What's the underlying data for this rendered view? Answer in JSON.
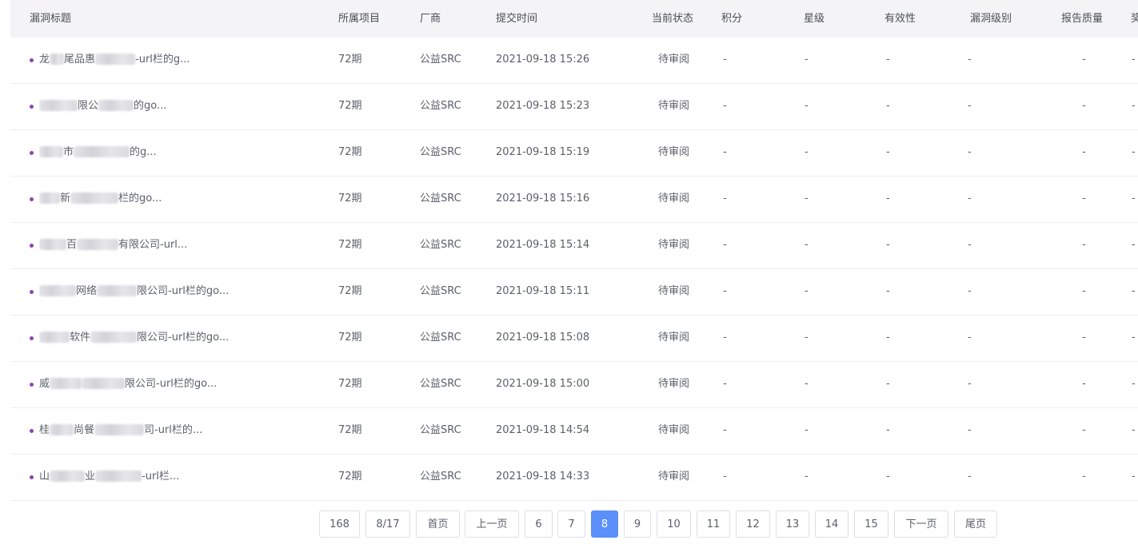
{
  "colors": {
    "bullet": "#8e44ad",
    "active_page": "#5b8ff9",
    "header_bg": "#f4f4f6"
  },
  "table": {
    "headers": {
      "title": "漏洞标题",
      "project": "所属项目",
      "vendor": "厂商",
      "submit_time": "提交时间",
      "status": "当前状态",
      "points": "积分",
      "stars": "星级",
      "validity": "有效性",
      "level": "漏洞级别",
      "quality": "报告质量",
      "extra": "奖"
    },
    "rows": [
      {
        "title_prefix": "龙",
        "title_mid": "尾品惠",
        "title_suffix": "-url栏的g...",
        "project": "72期",
        "vendor": "公益SRC",
        "submit_time": "2021-09-18 15:26",
        "status": "待审阅",
        "points": "-",
        "stars": "-",
        "validity": "-",
        "level": "-",
        "quality": "-",
        "extra": "-"
      },
      {
        "title_prefix": "",
        "title_mid": "限公",
        "title_suffix": "的go...",
        "project": "72期",
        "vendor": "公益SRC",
        "submit_time": "2021-09-18 15:23",
        "status": "待审阅",
        "points": "-",
        "stars": "-",
        "validity": "-",
        "level": "-",
        "quality": "-",
        "extra": "-"
      },
      {
        "title_prefix": "",
        "title_mid": "市",
        "title_suffix": "的g...",
        "project": "72期",
        "vendor": "公益SRC",
        "submit_time": "2021-09-18 15:19",
        "status": "待审阅",
        "points": "-",
        "stars": "-",
        "validity": "-",
        "level": "-",
        "quality": "-",
        "extra": "-"
      },
      {
        "title_prefix": "",
        "title_mid": "新",
        "title_suffix": "栏的go...",
        "project": "72期",
        "vendor": "公益SRC",
        "submit_time": "2021-09-18 15:16",
        "status": "待审阅",
        "points": "-",
        "stars": "-",
        "validity": "-",
        "level": "-",
        "quality": "-",
        "extra": "-"
      },
      {
        "title_prefix": "",
        "title_mid": "百",
        "title_suffix": "有限公司-url...",
        "project": "72期",
        "vendor": "公益SRC",
        "submit_time": "2021-09-18 15:14",
        "status": "待审阅",
        "points": "-",
        "stars": "-",
        "validity": "-",
        "level": "-",
        "quality": "-",
        "extra": "-"
      },
      {
        "title_prefix": "",
        "title_mid": "网络",
        "title_suffix": "限公司-url栏的go...",
        "project": "72期",
        "vendor": "公益SRC",
        "submit_time": "2021-09-18 15:11",
        "status": "待审阅",
        "points": "-",
        "stars": "-",
        "validity": "-",
        "level": "-",
        "quality": "-",
        "extra": "-"
      },
      {
        "title_prefix": "",
        "title_mid": "软件",
        "title_suffix": "限公司-url栏的go...",
        "project": "72期",
        "vendor": "公益SRC",
        "submit_time": "2021-09-18 15:08",
        "status": "待审阅",
        "points": "-",
        "stars": "-",
        "validity": "-",
        "level": "-",
        "quality": "-",
        "extra": "-"
      },
      {
        "title_prefix": "威",
        "title_mid": "",
        "title_suffix": "限公司-url栏的go...",
        "project": "72期",
        "vendor": "公益SRC",
        "submit_time": "2021-09-18 15:00",
        "status": "待审阅",
        "points": "-",
        "stars": "-",
        "validity": "-",
        "level": "-",
        "quality": "-",
        "extra": "-"
      },
      {
        "title_prefix": "桂",
        "title_mid": "尚餐",
        "title_suffix": "司-url栏的...",
        "project": "72期",
        "vendor": "公益SRC",
        "submit_time": "2021-09-18 14:54",
        "status": "待审阅",
        "points": "-",
        "stars": "-",
        "validity": "-",
        "level": "-",
        "quality": "-",
        "extra": "-"
      },
      {
        "title_prefix": "山",
        "title_mid": "业",
        "title_suffix": "-url栏...",
        "project": "72期",
        "vendor": "公益SRC",
        "submit_time": "2021-09-18 14:33",
        "status": "待审阅",
        "points": "-",
        "stars": "-",
        "validity": "-",
        "level": "-",
        "quality": "-",
        "extra": "-"
      }
    ]
  },
  "pagination": {
    "total": "168",
    "page_info": "8/17",
    "first": "首页",
    "prev": "上一页",
    "pages": [
      "6",
      "7",
      "8",
      "9",
      "10",
      "11",
      "12",
      "13",
      "14",
      "15"
    ],
    "current": "8",
    "next": "下一页",
    "last": "尾页"
  }
}
